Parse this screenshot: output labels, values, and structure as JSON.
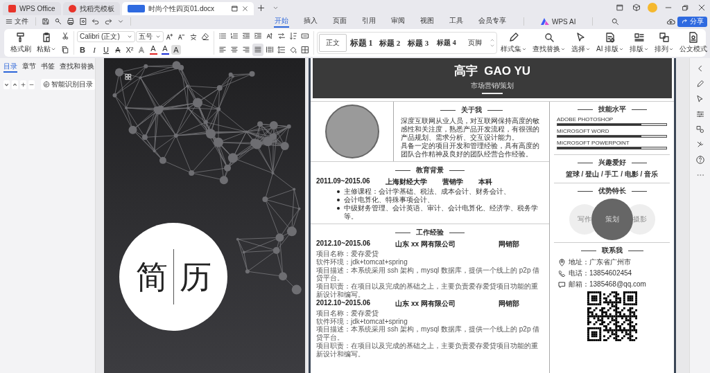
{
  "tabs": [
    {
      "label": "WPS Office",
      "kind": "home",
      "selected": false
    },
    {
      "label": "找稻壳模板",
      "kind": "template",
      "selected": false
    },
    {
      "label": "时尚个性四页01.docx",
      "kind": "doc",
      "selected": true
    }
  ],
  "menu": {
    "file": "文件",
    "tabs": [
      {
        "label": "开始",
        "selected": true
      },
      {
        "label": "插入",
        "selected": false
      },
      {
        "label": "页面",
        "selected": false
      },
      {
        "label": "引用",
        "selected": false
      },
      {
        "label": "审阅",
        "selected": false
      },
      {
        "label": "视图",
        "selected": false
      },
      {
        "label": "工具",
        "selected": false
      },
      {
        "label": "会员专享",
        "selected": false
      }
    ],
    "ai": "WPS AI",
    "share": "分享"
  },
  "ribbon": {
    "format_painter": "格式刷",
    "paste": "粘贴",
    "font": "Calibri (正文)",
    "size": "五号",
    "format_buttons": [
      {
        "label": "B",
        "kind": "bold"
      },
      {
        "label": "I",
        "kind": "italic"
      },
      {
        "label": "U",
        "kind": "underline"
      },
      {
        "label": "A",
        "kind": "strike"
      },
      {
        "label": "X²",
        "kind": "super"
      },
      {
        "label": "A",
        "kind": "effect"
      },
      {
        "label": "A",
        "kind": "color",
        "color": "#e02424"
      },
      {
        "label": "A",
        "kind": "color",
        "color": "#1b2fd6"
      },
      {
        "label": "A",
        "kind": "shade"
      }
    ],
    "alignment_buttons": [
      {
        "selected": false
      },
      {
        "selected": false
      },
      {
        "selected": false
      },
      {
        "selected": true
      },
      {
        "selected": false
      }
    ],
    "styles": [
      {
        "label": "正文",
        "kind": "body",
        "selected": true
      },
      {
        "label": "标题 1",
        "kind": "h1",
        "selected": false
      },
      {
        "label": "标题 2",
        "kind": "h2",
        "selected": false
      },
      {
        "label": "标题 3",
        "kind": "h3",
        "selected": false
      },
      {
        "label": "标题 4",
        "kind": "h4",
        "selected": false
      },
      {
        "label": "页脚",
        "kind": "footer",
        "selected": false
      }
    ],
    "commands": [
      {
        "label": "样式集",
        "kind": "brush",
        "dropdown": true
      },
      {
        "label": "查找替换",
        "kind": "search",
        "dropdown": true
      },
      {
        "label": "选择",
        "kind": "cursor",
        "dropdown": true
      },
      {
        "label": "AI 排版",
        "kind": "ai",
        "dropdown": true
      },
      {
        "label": "排版",
        "kind": "layout",
        "dropdown": true
      },
      {
        "label": "排列",
        "kind": "arrange",
        "dropdown": true
      },
      {
        "label": "公文模式",
        "kind": "official",
        "dropdown": false
      }
    ]
  },
  "nav_panel": {
    "tabs": [
      {
        "label": "目录",
        "selected": true
      },
      {
        "label": "章节",
        "selected": false
      },
      {
        "label": "书签",
        "selected": false
      },
      {
        "label": "查找和替换",
        "selected": false
      }
    ],
    "smart_toc": "智能识别目录"
  },
  "cover": {
    "logo_left": "简",
    "logo_right": "历"
  },
  "resume": {
    "name": "高宇  GAO YU",
    "title": "市场营销/策划",
    "about": {
      "heading": "关于我",
      "paragraphs": [
        "深度互联网从业人员，对互联网保持高度的敏感性和关注度，熟悉产品开发流程，有很强的产品规划、需求分析、交互设计能力。",
        "具备一定的项目开发和管理经验，具有高度的团队合作精神及良好的团队经营合作经验。"
      ]
    },
    "education": {
      "heading": "教育背景",
      "entries": [
        {
          "period": "2011.09~2015.06",
          "school": "上海财经大学",
          "major": "营销学",
          "degree": "本科",
          "bullets": [
            "主修课程：会计学基础、税法、成本会计、财务会计、",
            "会计电算化、特殊事项会计、",
            "中级财务管理、会计英语、审计、会计电算化、经济学、税务学等。"
          ]
        }
      ]
    },
    "work": {
      "heading": "工作经验",
      "entries": [
        {
          "period": "2012.10~2015.06",
          "company": "山东 xx 网有限公司",
          "department": "网销部",
          "lines": [
            "项目名称：爱存爱贷",
            "软件环境：jdk+tomcat+spring",
            "项目描述：本系统采用 ssh 架构，mysql 数据库，提供一个线上的 p2p 借贷平台。",
            "项目职责：在项目以及完成的基础之上，主要负责爱存爱贷项目功能的重新设计和编写。"
          ]
        },
        {
          "period": "2012.10~2015.06",
          "company": "山东 xx 网有限公司",
          "department": "网销部",
          "lines": [
            "项目名称：爱存爱贷",
            "软件环境：jdk+tomcat+spring",
            "项目描述：本系统采用 ssh 架构，mysql 数据库，提供一个线上的 p2p 借贷平台。",
            "项目职责：在项目以及完成的基础之上，主要负责爱存爱贷项目功能的重新设计和编写。"
          ]
        }
      ]
    },
    "skills": {
      "heading": "技能水平",
      "items": [
        {
          "name": "ADOBE PHOTOSHOP",
          "level": 0.77
        },
        {
          "name": "MICROSOFT WORD",
          "level": 0.77
        },
        {
          "name": "MICROSOFT POWERPOINT",
          "level": 0.77
        }
      ]
    },
    "hobbies": {
      "heading": "兴趣爱好",
      "text": "篮球 / 登山 / 手工 / 电影 / 音乐"
    },
    "strengths": {
      "heading": "优势特长",
      "items": [
        {
          "label": "写作",
          "kind": "minor"
        },
        {
          "label": "策划",
          "kind": "major"
        },
        {
          "label": "摄影",
          "kind": "minor"
        }
      ]
    },
    "contact": {
      "heading": "联系我",
      "items": [
        {
          "kind": "address",
          "text": "地址：广东省广州市"
        },
        {
          "kind": "phone",
          "text": "电话：13854602454"
        },
        {
          "kind": "email",
          "text": "邮箱：1385468@qq.com"
        }
      ]
    }
  }
}
